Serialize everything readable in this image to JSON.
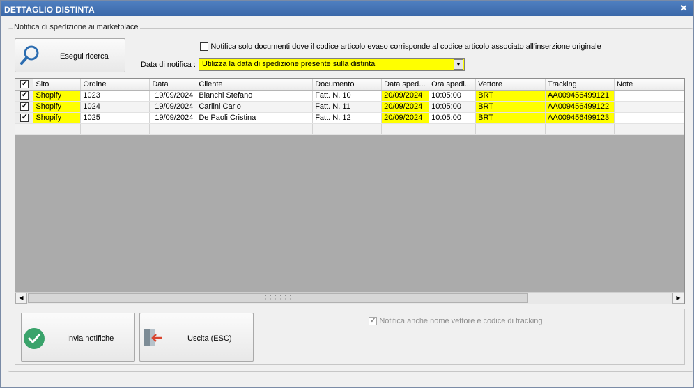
{
  "window": {
    "title": "DETTAGLIO DISTINTA",
    "close_icon": "close-icon"
  },
  "group": {
    "legend": "Notifica di spedizione ai marketplace"
  },
  "search_button": {
    "label": "Esegui ricerca",
    "icon": "magnifier-icon"
  },
  "filter": {
    "only_matching_label": "Notifica solo documenti dove il codice articolo evaso corrisponde al codice articolo associato all'inserzione originale",
    "only_matching_checked": false
  },
  "notify_date": {
    "label": "Data di notifica :",
    "selected": "Utilizza la data di spedizione presente sulla distinta"
  },
  "grid": {
    "columns": [
      "Sito",
      "Ordine",
      "Data",
      "Cliente",
      "Documento",
      "Data sped...",
      "Ora spedi...",
      "Vettore",
      "Tracking",
      "Note"
    ],
    "rows": [
      {
        "checked": true,
        "sito": "Shopify",
        "ordine": "1023",
        "data": "19/09/2024",
        "cliente": "Bianchi Stefano",
        "documento": "Fatt. N. 10",
        "data_sped": "20/09/2024",
        "ora_sped": "10:05:00",
        "vettore": "BRT",
        "tracking": "AA009456499121",
        "note": ""
      },
      {
        "checked": true,
        "sito": "Shopify",
        "ordine": "1024",
        "data": "19/09/2024",
        "cliente": "Carlini Carlo",
        "documento": "Fatt. N. 11",
        "data_sped": "20/09/2024",
        "ora_sped": "10:05:00",
        "vettore": "BRT",
        "tracking": "AA009456499122",
        "note": ""
      },
      {
        "checked": true,
        "sito": "Shopify",
        "ordine": "1025",
        "data": "19/09/2024",
        "cliente": "De Paoli Cristina",
        "documento": "Fatt. N. 12",
        "data_sped": "20/09/2024",
        "ora_sped": "10:05:00",
        "vettore": "BRT",
        "tracking": "AA009456499123",
        "note": ""
      }
    ],
    "highlight_color": "#ffff00"
  },
  "actions": {
    "send_label": "Invia notifiche",
    "send_icon": "check-circle-icon",
    "exit_label": "Uscita (ESC)",
    "exit_icon": "exit-door-icon",
    "include_carrier_label": "Notifica anche nome vettore e codice di tracking",
    "include_carrier_checked": true
  }
}
